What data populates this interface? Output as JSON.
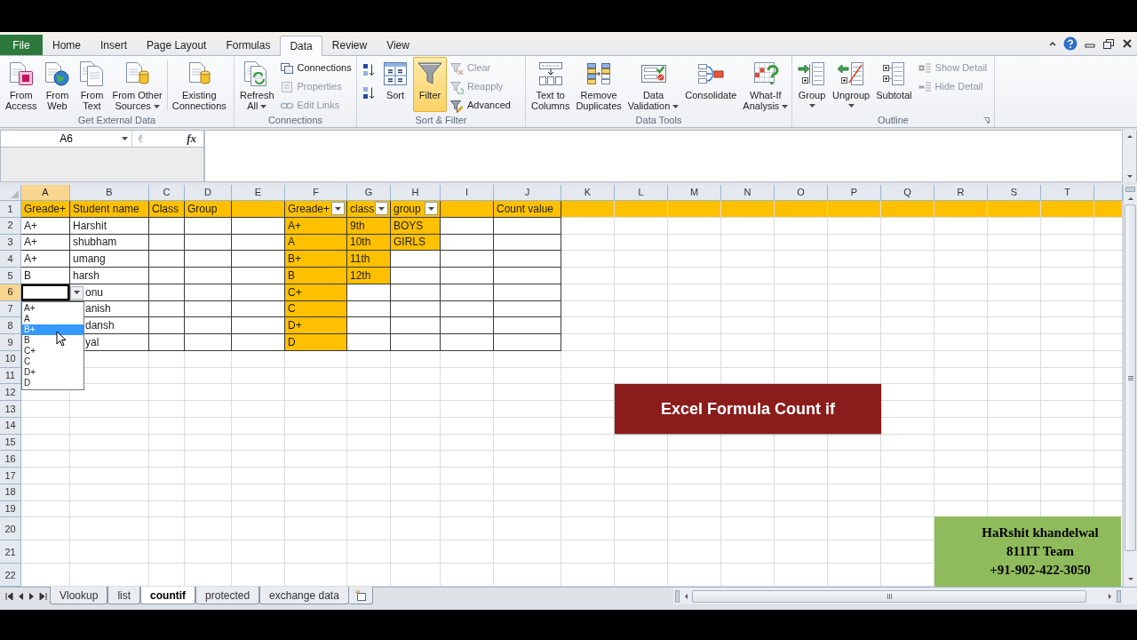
{
  "ribbon_tabs": [
    {
      "label": "File",
      "kind": "backstage",
      "selected": false
    },
    {
      "label": "Home",
      "kind": "tab",
      "selected": false
    },
    {
      "label": "Insert",
      "kind": "tab",
      "selected": false
    },
    {
      "label": "Page Layout",
      "kind": "tab",
      "selected": false
    },
    {
      "label": "Formulas",
      "kind": "tab",
      "selected": false
    },
    {
      "label": "Data",
      "kind": "tab",
      "selected": true
    },
    {
      "label": "Review",
      "kind": "tab",
      "selected": false
    },
    {
      "label": "View",
      "kind": "tab",
      "selected": false
    }
  ],
  "ribbon_groups": [
    {
      "label": "Get External Data",
      "items": [
        {
          "kind": "large",
          "label": "From\nAccess"
        },
        {
          "kind": "large",
          "label": "From\nWeb"
        },
        {
          "kind": "large",
          "label": "From\nText"
        },
        {
          "kind": "large",
          "label": "From Other\nSources",
          "menu": true
        },
        {
          "kind": "large",
          "label": "Existing\nConnections",
          "divider_before": true
        }
      ]
    },
    {
      "label": "Connections",
      "items": [
        {
          "kind": "large",
          "label": "Refresh\nAll",
          "menu": true
        },
        {
          "kind": "stack",
          "items": [
            {
              "label": "Connections",
              "disabled": false
            },
            {
              "label": "Properties",
              "disabled": true
            },
            {
              "label": "Edit Links",
              "disabled": true
            }
          ]
        }
      ]
    },
    {
      "label": "Sort & Filter",
      "items": [
        {
          "kind": "stack",
          "items": [
            {
              "disabled": false
            },
            {
              "disabled": false
            }
          ]
        },
        {
          "kind": "large",
          "label": "Sort"
        },
        {
          "kind": "large",
          "label": "Filter",
          "on": true
        },
        {
          "kind": "stack",
          "items": [
            {
              "label": "Clear",
              "disabled": true
            },
            {
              "label": "Reapply",
              "disabled": true
            },
            {
              "label": "Advanced",
              "disabled": false
            }
          ]
        }
      ]
    },
    {
      "label": "Data Tools",
      "items": [
        {
          "kind": "large",
          "label": "Text to\nColumns"
        },
        {
          "kind": "large",
          "label": "Remove\nDuplicates"
        },
        {
          "kind": "large",
          "label": "Data\nValidation",
          "menu": true
        },
        {
          "kind": "large",
          "label": "Consolidate"
        },
        {
          "kind": "large",
          "label": "What-If\nAnalysis",
          "menu": true
        }
      ]
    },
    {
      "label": "Outline",
      "launcher": true,
      "items": [
        {
          "kind": "large",
          "label": "Group",
          "menu": true
        },
        {
          "kind": "large",
          "label": "Ungroup",
          "menu": true
        },
        {
          "kind": "large",
          "label": "Subtotal"
        },
        {
          "kind": "stack",
          "items": [
            {
              "label": "Show Detail",
              "disabled": true
            },
            {
              "label": "Hide Detail",
              "disabled": true
            }
          ]
        }
      ]
    }
  ],
  "formula_bar": {
    "name_box": "A6",
    "function_button": "fx"
  },
  "grid": {
    "columns": [
      {
        "label": "A",
        "selected": true
      },
      {
        "label": "B",
        "selected": false
      },
      {
        "label": "C",
        "selected": false
      },
      {
        "label": "D",
        "selected": false
      },
      {
        "label": "E",
        "selected": false
      },
      {
        "label": "F",
        "selected": false
      },
      {
        "label": "G",
        "selected": false
      },
      {
        "label": "H",
        "selected": false
      },
      {
        "label": "I",
        "selected": false
      },
      {
        "label": "J",
        "selected": false
      },
      {
        "label": "K",
        "selected": false
      },
      {
        "label": "L",
        "selected": false
      },
      {
        "label": "M",
        "selected": false
      },
      {
        "label": "N",
        "selected": false
      },
      {
        "label": "O",
        "selected": false
      },
      {
        "label": "P",
        "selected": false
      },
      {
        "label": "Q",
        "selected": false
      },
      {
        "label": "R",
        "selected": false
      },
      {
        "label": "S",
        "selected": false
      },
      {
        "label": "T",
        "selected": false
      },
      {
        "selected": false
      }
    ],
    "rows": [
      {
        "number": "1",
        "selected": false,
        "bordered": true,
        "highlighted": true,
        "cells": [
          {
            "text": "Greade+",
            "filter_button": false
          },
          {
            "text": "Student name",
            "filter_button": false
          },
          {
            "text": "Class",
            "filter_button": false
          },
          {
            "text": "Group",
            "filter_button": false
          },
          {
            "filter_button": false
          },
          {
            "text": "Greade+",
            "filter_button": true
          },
          {
            "text": "class",
            "filter_button": true
          },
          {
            "text": "group",
            "filter_button": true
          },
          {
            "filter_button": false
          },
          {
            "text": "Count value",
            "filter_button": false
          }
        ]
      },
      {
        "number": "2",
        "selected": false,
        "bordered": true,
        "cells": [
          {
            "text": "A+",
            "highlighted": false
          },
          {
            "text": "Harshit",
            "highlighted": false
          },
          {
            "highlighted": false
          },
          {
            "highlighted": false
          },
          {
            "highlighted": false
          },
          {
            "text": "A+",
            "highlighted": true
          },
          {
            "text": "9th",
            "highlighted": true
          },
          {
            "text": "BOYS",
            "highlighted": true
          },
          {
            "highlighted": false
          },
          {
            "highlighted": false
          }
        ]
      },
      {
        "number": "3",
        "selected": false,
        "bordered": true,
        "cells": [
          {
            "text": "A+",
            "highlighted": false
          },
          {
            "text": "shubham",
            "highlighted": false
          },
          {
            "highlighted": false
          },
          {
            "highlighted": false
          },
          {
            "highlighted": false
          },
          {
            "text": "A",
            "highlighted": true
          },
          {
            "text": "10th",
            "highlighted": true
          },
          {
            "text": "GIRLS",
            "highlighted": true
          },
          {
            "highlighted": false
          },
          {
            "highlighted": false
          }
        ]
      },
      {
        "number": "4",
        "selected": false,
        "bordered": true,
        "cells": [
          {
            "text": "A+",
            "highlighted": false
          },
          {
            "text": "umang",
            "highlighted": false
          },
          {
            "highlighted": false
          },
          {
            "highlighted": false
          },
          {
            "highlighted": false
          },
          {
            "text": "B+",
            "highlighted": true
          },
          {
            "text": "11th",
            "highlighted": true
          },
          {
            "highlighted": false
          },
          {
            "highlighted": false
          },
          {
            "highlighted": false
          }
        ]
      },
      {
        "number": "5",
        "selected": false,
        "bordered": true,
        "cells": [
          {
            "text": "B",
            "highlighted": false
          },
          {
            "text": "harsh",
            "highlighted": false
          },
          {
            "highlighted": false
          },
          {
            "highlighted": false
          },
          {
            "highlighted": false
          },
          {
            "text": "B",
            "highlighted": true
          },
          {
            "text": "12th",
            "highlighted": true
          },
          {
            "highlighted": false
          },
          {
            "highlighted": false
          },
          {
            "highlighted": false
          }
        ]
      },
      {
        "number": "6",
        "selected": true,
        "bordered": true,
        "cells": [
          {
            "highlighted": false
          },
          {
            "text": "onu",
            "highlighted": false
          },
          {
            "highlighted": false
          },
          {
            "highlighted": false
          },
          {
            "highlighted": false
          },
          {
            "text": "C+",
            "highlighted": true
          },
          {
            "highlighted": false
          },
          {
            "highlighted": false
          },
          {
            "highlighted": false
          },
          {
            "highlighted": false
          }
        ]
      },
      {
        "number": "7",
        "selected": false,
        "bordered": true,
        "cells": [
          {},
          {
            "text": "anish",
            "highlighted": false
          },
          {
            "highlighted": false
          },
          {
            "highlighted": false
          },
          {
            "highlighted": false
          },
          {
            "text": "C",
            "highlighted": true
          },
          {
            "highlighted": false
          },
          {
            "highlighted": false
          },
          {
            "highlighted": false
          },
          {
            "highlighted": false
          }
        ]
      },
      {
        "number": "8",
        "selected": false,
        "bordered": true,
        "cells": [
          {},
          {
            "text": "dansh",
            "highlighted": false
          },
          {
            "highlighted": false
          },
          {
            "highlighted": false
          },
          {
            "highlighted": false
          },
          {
            "text": "D+",
            "highlighted": true
          },
          {
            "highlighted": false
          },
          {
            "highlighted": false
          },
          {
            "highlighted": false
          },
          {
            "highlighted": false
          }
        ]
      },
      {
        "number": "9",
        "selected": false,
        "bordered": true,
        "cells": [
          {},
          {
            "text": "yal",
            "highlighted": false
          },
          {
            "highlighted": false
          },
          {
            "highlighted": false
          },
          {
            "highlighted": false
          },
          {
            "text": "D",
            "highlighted": true
          },
          {
            "highlighted": false
          },
          {
            "highlighted": false
          },
          {
            "highlighted": false
          },
          {
            "highlighted": false
          }
        ]
      },
      {
        "number": "10",
        "selected": false
      },
      {
        "number": "11",
        "selected": false
      },
      {
        "number": "12",
        "selected": false
      },
      {
        "number": "13",
        "selected": false
      },
      {
        "number": "14",
        "selected": false
      },
      {
        "number": "15",
        "selected": false
      },
      {
        "number": "16",
        "selected": false
      },
      {
        "number": "17",
        "selected": false
      },
      {
        "number": "18",
        "selected": false
      },
      {
        "number": "19",
        "selected": false
      },
      {
        "number": "20",
        "selected": false
      },
      {
        "number": "21",
        "selected": false
      },
      {
        "number": "22",
        "selected": false
      }
    ]
  },
  "validation_dropdown": {
    "open": true,
    "items": [
      {
        "label": "A+",
        "selected": false
      },
      {
        "label": "A",
        "selected": false
      },
      {
        "label": "B+",
        "selected": true
      },
      {
        "label": "B",
        "selected": false
      },
      {
        "label": "C+",
        "selected": false
      },
      {
        "label": "C",
        "selected": false
      },
      {
        "label": "D+",
        "selected": false
      },
      {
        "label": "D",
        "selected": false
      }
    ]
  },
  "shapes": [
    {
      "kind": "banner",
      "text": "Excel Formula Count if",
      "color": "#8b1c1c"
    },
    {
      "kind": "note",
      "lines": [
        "HaRshit khandelwal",
        "811IT Team",
        "+91-902-422-3050"
      ],
      "color": "#8fbb5c"
    }
  ],
  "sheet_tabs": [
    {
      "label": "Vlookup",
      "selected": false
    },
    {
      "label": "list",
      "selected": false
    },
    {
      "label": "countif",
      "selected": true
    },
    {
      "label": "protected",
      "selected": false
    },
    {
      "label": "exchange data",
      "selected": false
    }
  ]
}
